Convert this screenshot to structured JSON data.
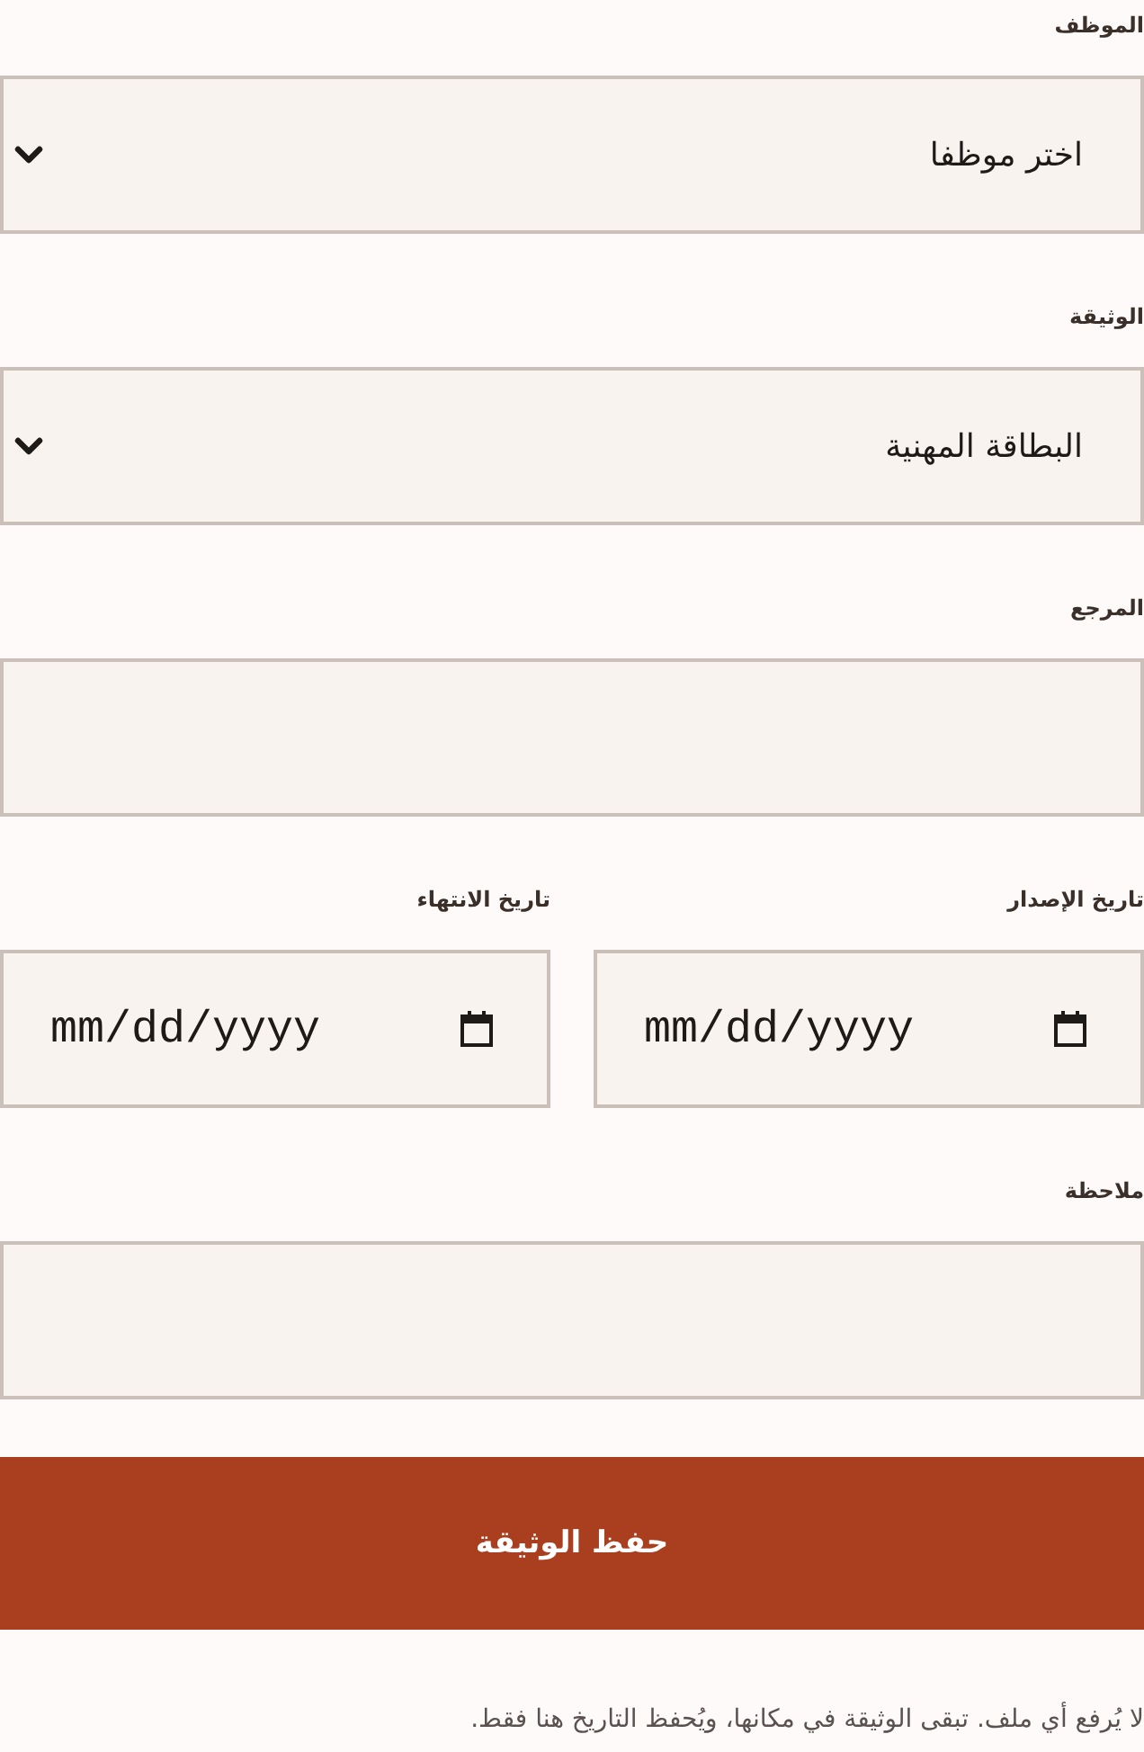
{
  "form": {
    "rows": [
      {
        "kind": "select",
        "label": "الموظف",
        "value": "اختر موظفا"
      },
      {
        "kind": "select",
        "label": "الوثيقة",
        "value": "البطاقة المهنية"
      },
      {
        "kind": "text",
        "label": "المرجع"
      },
      {
        "kind": "dates",
        "fields": [
          {
            "label": "تاريخ الإصدار",
            "placeholder": "mm/dd/yyyy"
          },
          {
            "label": "تاريخ الانتهاء",
            "placeholder": "mm/dd/yyyy"
          }
        ]
      },
      {
        "kind": "text",
        "label": "ملاحظة"
      }
    ],
    "submit": "حفظ الوثيقة",
    "note": "لا يُرفع أي ملف. تبقى الوثيقة في مكانها، ويُحفظ التاريخ هنا فقط."
  }
}
